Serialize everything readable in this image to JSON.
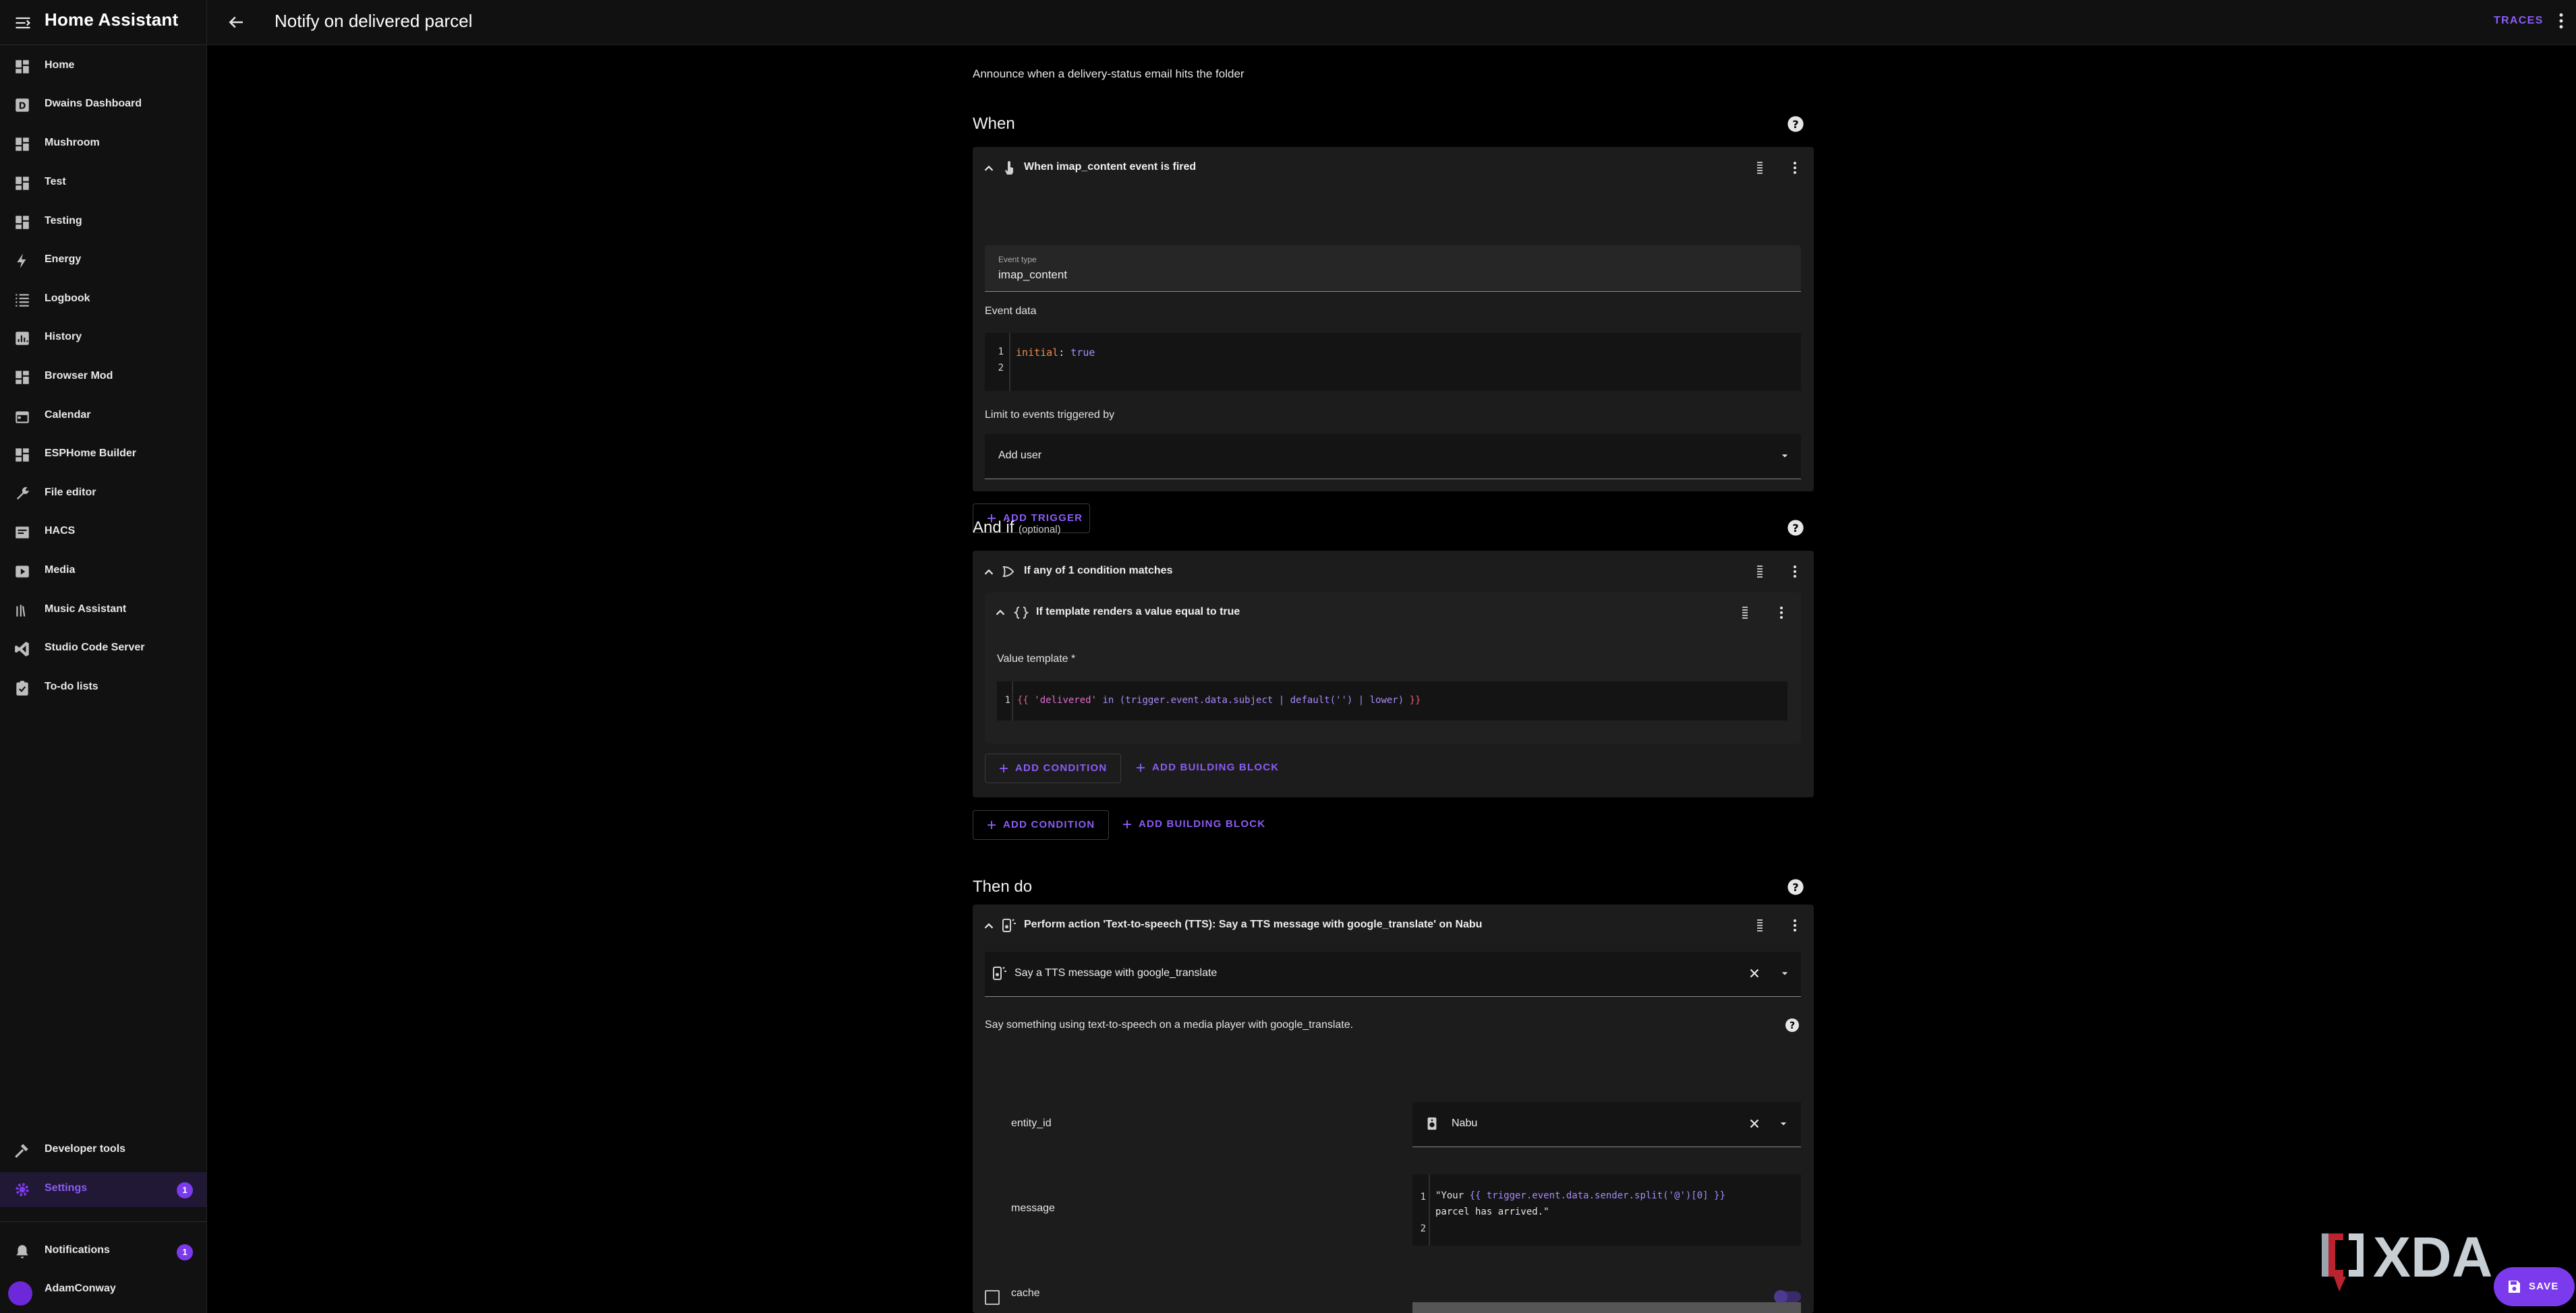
{
  "app": {
    "title": "Home Assistant"
  },
  "sidebar": {
    "items": [
      {
        "label": "Home",
        "icon": "dashboard-icon"
      },
      {
        "label": "Dwains Dashboard",
        "icon": "dwains-icon"
      },
      {
        "label": "Mushroom",
        "icon": "dashboard-icon"
      },
      {
        "label": "Test",
        "icon": "dashboard-icon"
      },
      {
        "label": "Testing",
        "icon": "dashboard-icon"
      },
      {
        "label": "Energy",
        "icon": "lightning-icon"
      },
      {
        "label": "Logbook",
        "icon": "list-icon"
      },
      {
        "label": "History",
        "icon": "chart-box-icon"
      },
      {
        "label": "Browser Mod",
        "icon": "dashboard-icon"
      },
      {
        "label": "Calendar",
        "icon": "calendar-icon"
      },
      {
        "label": "ESPHome Builder",
        "icon": "dashboard-icon"
      },
      {
        "label": "File editor",
        "icon": "wrench-icon"
      },
      {
        "label": "HACS",
        "icon": "hacs-icon"
      },
      {
        "label": "Media",
        "icon": "media-icon"
      },
      {
        "label": "Music Assistant",
        "icon": "music-assistant-icon"
      },
      {
        "label": "Studio Code Server",
        "icon": "vscode-icon"
      },
      {
        "label": "To-do lists",
        "icon": "clipboard-check-icon"
      }
    ],
    "bottom": {
      "developer_tools": "Developer tools",
      "settings": "Settings",
      "settings_badge": "1",
      "notifications": "Notifications",
      "notifications_badge": "1",
      "user": "AdamConway"
    }
  },
  "topbar": {
    "title": "Notify on delivered parcel",
    "traces": "TRACES"
  },
  "editor": {
    "description": "Announce when a delivery-status email hits the folder",
    "when": {
      "title": "When",
      "trigger": {
        "header": "When imap_content event is fired",
        "event_type_label": "Event type",
        "event_type_value": "imap_content",
        "event_data_label": "Event data",
        "code_ln1": "1",
        "code_ln2": "2",
        "code_key": "initial",
        "code_colon": ":",
        "code_value": "true",
        "limit_label": "Limit to events triggered by",
        "add_user": "Add user"
      },
      "add_trigger": "ADD TRIGGER"
    },
    "and_if": {
      "title": "And if",
      "optional": "(optional)",
      "condition": {
        "header": "If any of 1 condition matches",
        "sub_header": "If template renders a value equal to true",
        "value_template_label": "Value template *",
        "code_ln1": "1",
        "tpl_open": "{{",
        "tpl_str": "'delivered'",
        "tpl_body": " in (trigger.event.data.subject | default('') | lower) ",
        "tpl_close": "}}",
        "inner_add_condition": "ADD CONDITION",
        "inner_add_building_block": "ADD BUILDING BLOCK"
      },
      "add_condition": "ADD CONDITION",
      "add_building_block": "ADD BUILDING BLOCK"
    },
    "then_do": {
      "title": "Then do",
      "action": {
        "header": "Perform action 'Text-to-speech (TTS): Say a TTS message with google_translate' on Nabu",
        "service_value": "Say a TTS message with google_translate",
        "service_desc": "Say something using text-to-speech on a media player with google_translate.",
        "entity_label": "entity_id",
        "entity_value": "Nabu",
        "message_label": "message",
        "msg_ln1": "1",
        "msg_ln2": "2",
        "msg_part1": "\"Your ",
        "msg_tpl": "{{ trigger.event.data.sender.split('@')[0] }}",
        "msg_part2": "parcel has arrived.\"",
        "cache_label": "cache"
      }
    }
  },
  "fab": {
    "save": "SAVE"
  },
  "watermark": {
    "text": "XDA"
  },
  "colors": {
    "accent": "#7c3aed",
    "accent_text": "#8b5cf6",
    "background": "#000000",
    "card": "#1c1c1c"
  }
}
